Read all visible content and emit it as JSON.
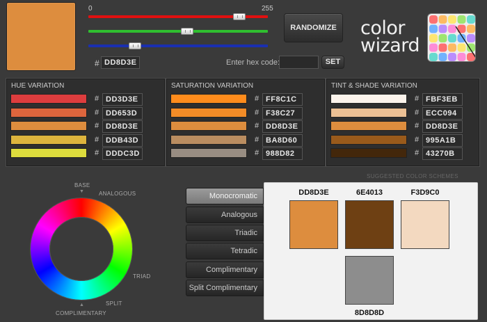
{
  "current_color": {
    "hex": "DD8D3E",
    "swatch": "#DD8D3E"
  },
  "sliders": {
    "min_label": "0",
    "max_label": "255",
    "red": {
      "value": 221,
      "color": "#e01010"
    },
    "green": {
      "value": 141,
      "color": "#2fbf2f"
    },
    "blue": {
      "value": 62,
      "color": "#1a2fb0"
    }
  },
  "buttons": {
    "randomize": "RANDOMIZE",
    "set": "SET"
  },
  "hex_input": {
    "label": "Enter hex code:",
    "value": ""
  },
  "logo": {
    "line1": "color",
    "line2": "wizard"
  },
  "hue_variation": {
    "title": "HUE VARIATION",
    "rows": [
      {
        "hex": "DD3D3E",
        "color": "#DD3D3E"
      },
      {
        "hex": "DD653D",
        "color": "#DD653D"
      },
      {
        "hex": "DD8D3E",
        "color": "#DD8D3E"
      },
      {
        "hex": "DDB43D",
        "color": "#DDB43D"
      },
      {
        "hex": "DDDC3D",
        "color": "#DDDC3D"
      }
    ]
  },
  "saturation_variation": {
    "title": "SATURATION VARIATION",
    "rows": [
      {
        "hex": "FF8C1C",
        "color": "#FF8C1C"
      },
      {
        "hex": "F38C27",
        "color": "#F38C27"
      },
      {
        "hex": "DD8D3E",
        "color": "#DD8D3E"
      },
      {
        "hex": "BA8D60",
        "color": "#BA8D60"
      },
      {
        "hex": "988D82",
        "color": "#988D82"
      }
    ]
  },
  "tint_shade_variation": {
    "title": "TINT & SHADE VARIATION",
    "rows": [
      {
        "hex": "FBF3EB",
        "color": "#FBF3EB"
      },
      {
        "hex": "ECC094",
        "color": "#ECC094"
      },
      {
        "hex": "DD8D3E",
        "color": "#DD8D3E"
      },
      {
        "hex": "995A1B",
        "color": "#995A1B"
      },
      {
        "hex": "43270B",
        "color": "#43270B"
      }
    ]
  },
  "wheel_labels": {
    "base": "BASE",
    "analogous": "ANALOGOUS",
    "triad": "TRIAD",
    "split": "SPLIT",
    "complimentary": "COMPLIMENTARY"
  },
  "schemes": {
    "title": "SUGGESTED COLOR SCHEMES",
    "buttons": [
      "Monocromatic",
      "Analogous",
      "Triadic",
      "Tetradic",
      "Complimentary",
      "Split Complimentary"
    ],
    "active": "Monocromatic",
    "swatches": [
      {
        "hex": "DD8D3E",
        "color": "#DD8D3E"
      },
      {
        "hex": "6E4013",
        "color": "#6E4013"
      },
      {
        "hex": "F3D9C0",
        "color": "#F3D9C0"
      },
      {
        "hex": "8D8D8D",
        "color": "#8D8D8D"
      }
    ]
  }
}
